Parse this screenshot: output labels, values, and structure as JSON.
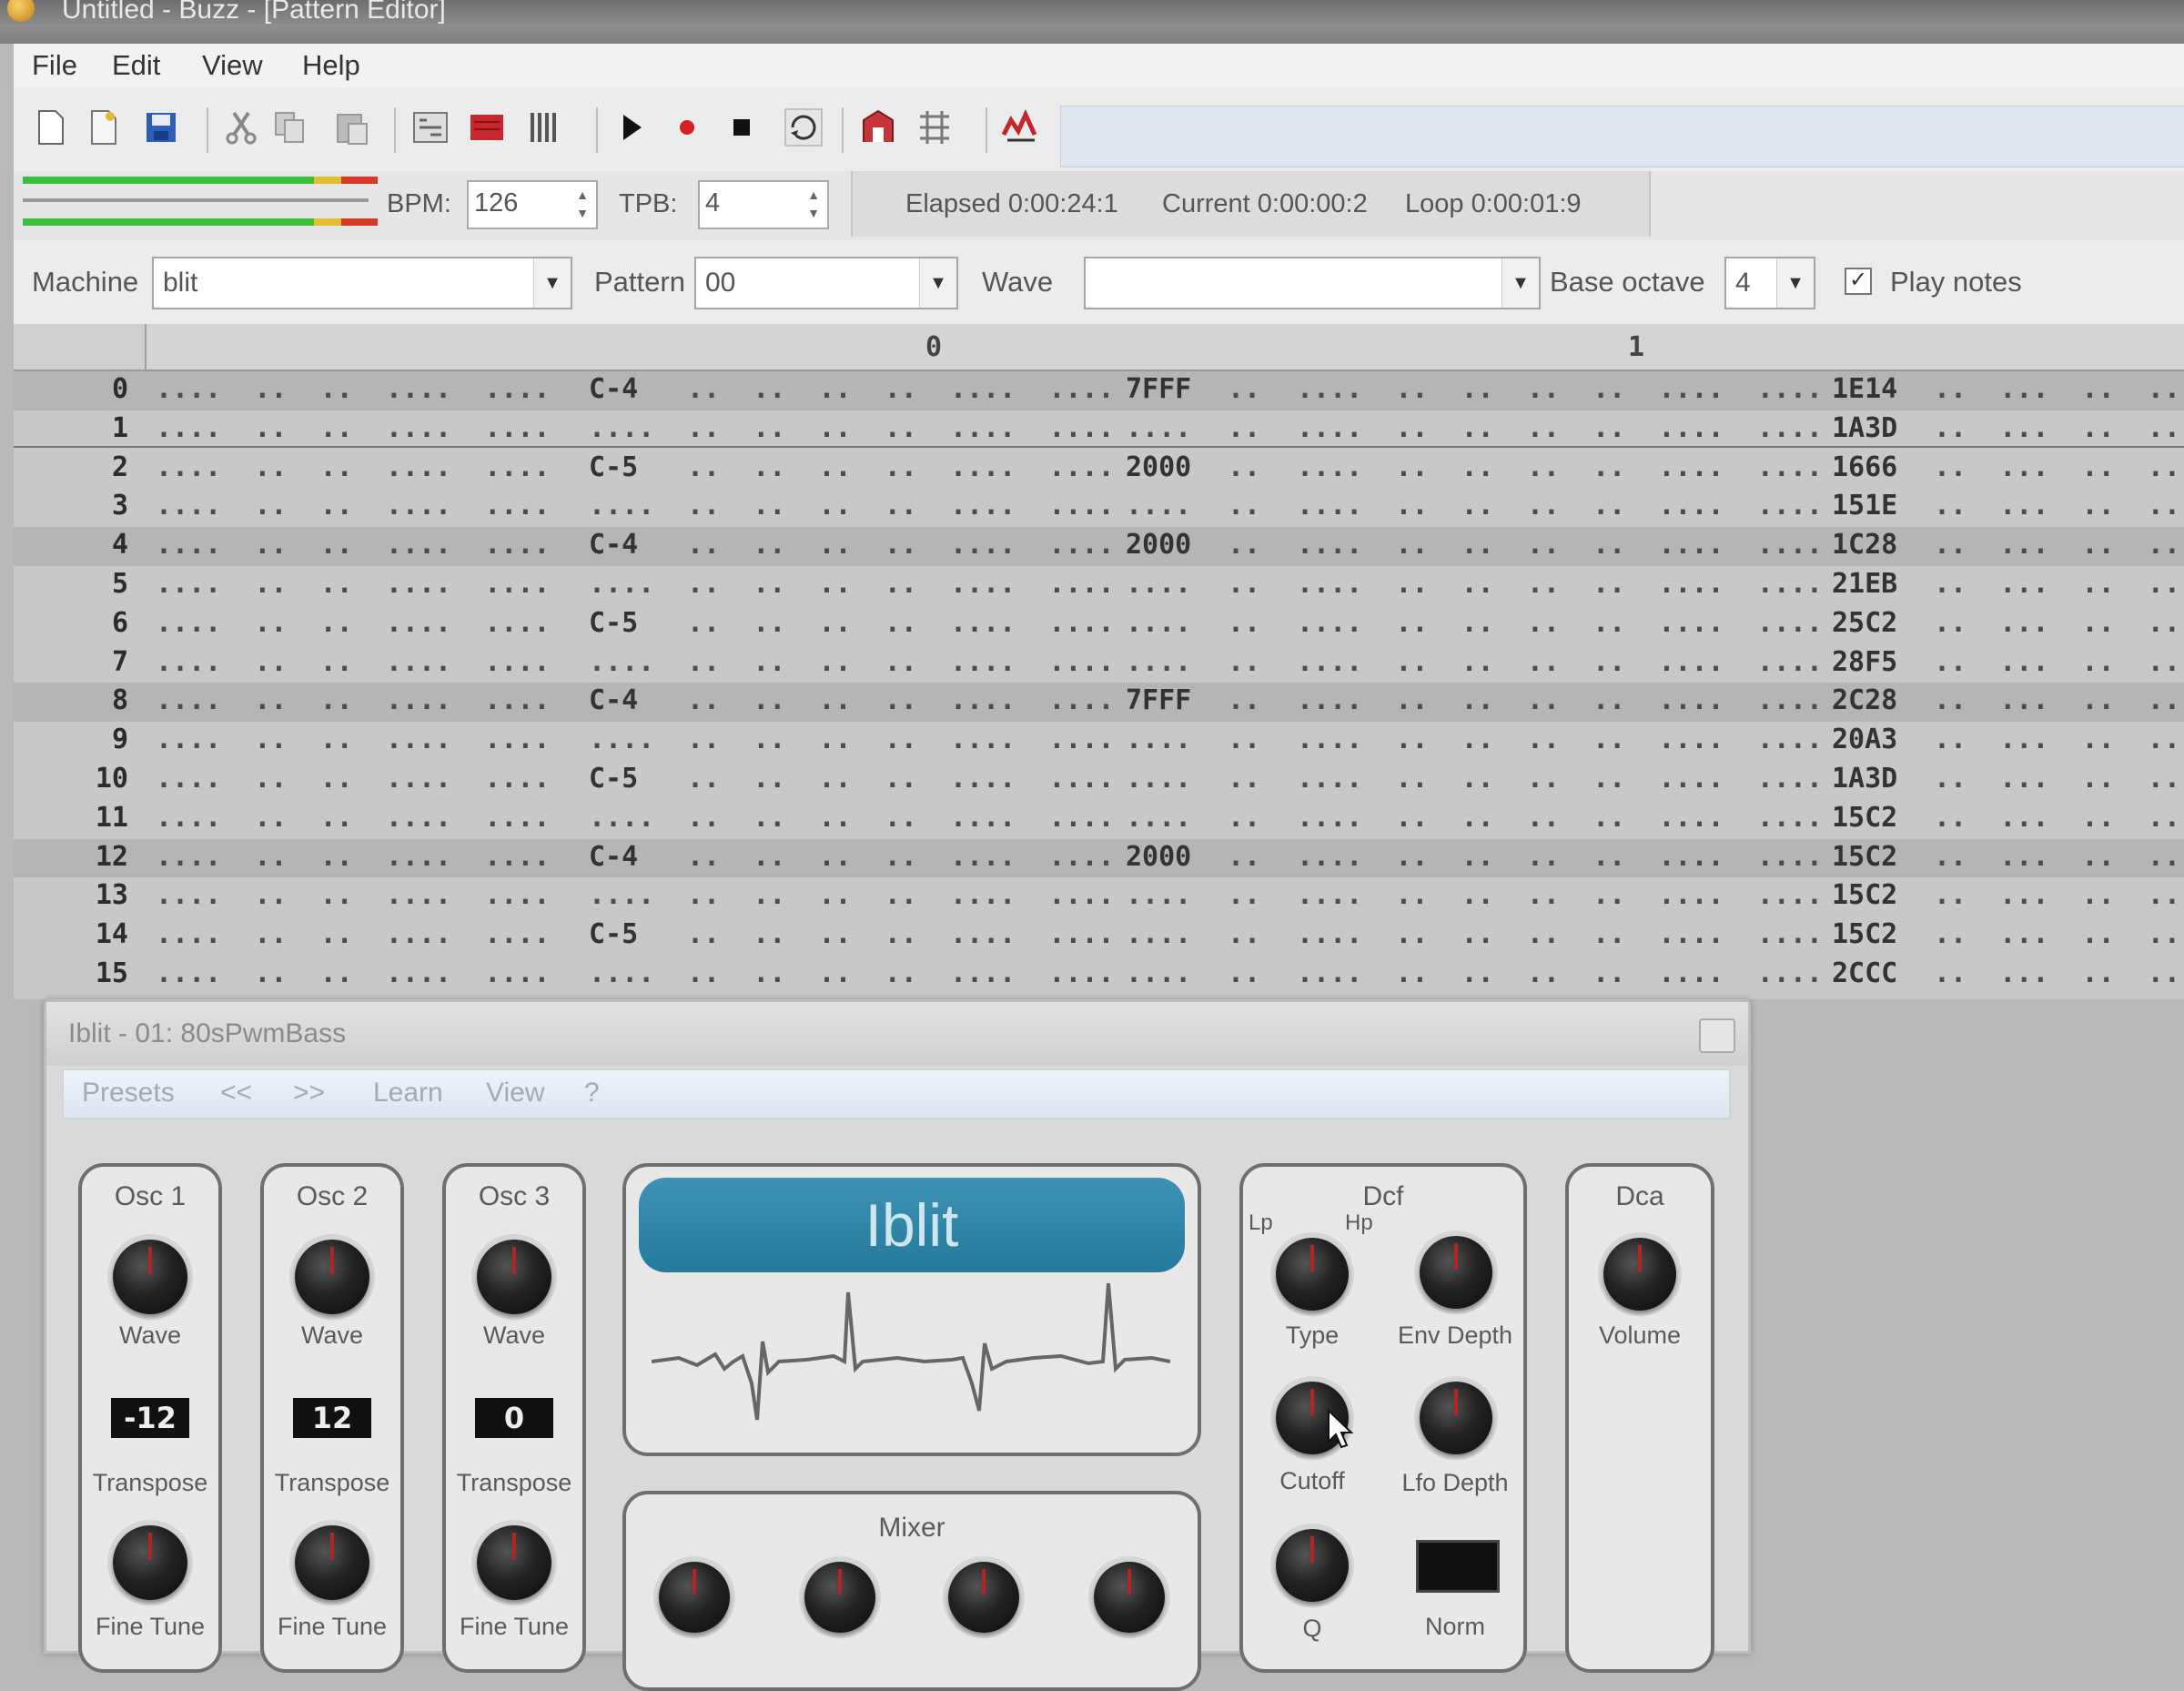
{
  "window": {
    "title": "Untitled - Buzz - [Pattern Editor]"
  },
  "menu": [
    "File",
    "Edit",
    "View",
    "Help"
  ],
  "toolbar_icons": [
    "new-icon",
    "open-icon",
    "save-icon",
    "cut-icon",
    "copy-icon",
    "paste-icon",
    "machines-view-icon",
    "patterns-view-icon",
    "sequence-view-icon",
    "play-icon",
    "record-icon",
    "stop-icon",
    "loop-icon",
    "wave-table-icon",
    "properties-icon",
    "cpu-icon"
  ],
  "transport": {
    "bpm_label": "BPM:",
    "bpm_value": "126",
    "tpb_label": "TPB:",
    "tpb_value": "4",
    "elapsed": "Elapsed 0:00:24:1",
    "current": "Current 0:00:00:2",
    "loop": "Loop 0:00:01:9"
  },
  "machine_row": {
    "machine_label": "Machine",
    "machine_value": "blit",
    "pattern_label": "Pattern",
    "pattern_value": "00",
    "wave_label": "Wave",
    "wave_value": "",
    "octave_label": "Base octave",
    "octave_value": "4",
    "play_notes_label": "Play notes",
    "play_notes_checked": true
  },
  "pattern": {
    "track_headers": [
      "0",
      "1"
    ],
    "rows": [
      {
        "n": "0",
        "note": "C-4",
        "v1": "7FFF",
        "v2": "1E14"
      },
      {
        "n": "1",
        "note": "",
        "v1": "",
        "v2": "1A3D"
      },
      {
        "n": "2",
        "note": "C-5",
        "v1": "2000",
        "v2": "1666"
      },
      {
        "n": "3",
        "note": "",
        "v1": "",
        "v2": "151E"
      },
      {
        "n": "4",
        "note": "C-4",
        "v1": "2000",
        "v2": "1C28"
      },
      {
        "n": "5",
        "note": "",
        "v1": "",
        "v2": "21EB"
      },
      {
        "n": "6",
        "note": "C-5",
        "v1": "",
        "v2": "25C2"
      },
      {
        "n": "7",
        "note": "",
        "v1": "",
        "v2": "28F5"
      },
      {
        "n": "8",
        "note": "C-4",
        "v1": "7FFF",
        "v2": "2C28"
      },
      {
        "n": "9",
        "note": "",
        "v1": "",
        "v2": "20A3"
      },
      {
        "n": "10",
        "note": "C-5",
        "v1": "",
        "v2": "1A3D"
      },
      {
        "n": "11",
        "note": "",
        "v1": "",
        "v2": "15C2"
      },
      {
        "n": "12",
        "note": "C-4",
        "v1": "2000",
        "v2": "15C2"
      },
      {
        "n": "13",
        "note": "",
        "v1": "",
        "v2": "15C2"
      },
      {
        "n": "14",
        "note": "C-5",
        "v1": "",
        "v2": "15C2"
      },
      {
        "n": "15",
        "note": "",
        "v1": "",
        "v2": "2CCC"
      }
    ]
  },
  "plugin": {
    "title": "Iblit - 01: 80sPwmBass",
    "menu": [
      "Presets",
      "<<",
      ">>",
      "Learn",
      "View",
      "?"
    ],
    "logo": "Iblit",
    "osc": [
      {
        "name": "Osc 1",
        "wave": "Wave",
        "transpose_value": "-12",
        "transpose": "Transpose",
        "fine": "Fine Tune"
      },
      {
        "name": "Osc 2",
        "wave": "Wave",
        "transpose_value": "12",
        "transpose": "Transpose",
        "fine": "Fine Tune"
      },
      {
        "name": "Osc 3",
        "wave": "Wave",
        "transpose_value": "0",
        "transpose": "Transpose",
        "fine": "Fine Tune"
      }
    ],
    "dcf": {
      "name": "Dcf",
      "lp": "Lp",
      "hp": "Hp",
      "type": "Type",
      "env_depth": "Env Depth",
      "cutoff": "Cutoff",
      "lfo_depth": "Lfo Depth",
      "q": "Q",
      "norm": "Norm"
    },
    "dca": {
      "name": "Dca",
      "volume": "Volume"
    },
    "mixer": {
      "name": "Mixer"
    }
  },
  "colors": {
    "logo_blue": "#2f86a8",
    "meter_green": "#3cbf3c",
    "meter_red": "#d83a2a",
    "knob_indicator": "#b32424"
  }
}
